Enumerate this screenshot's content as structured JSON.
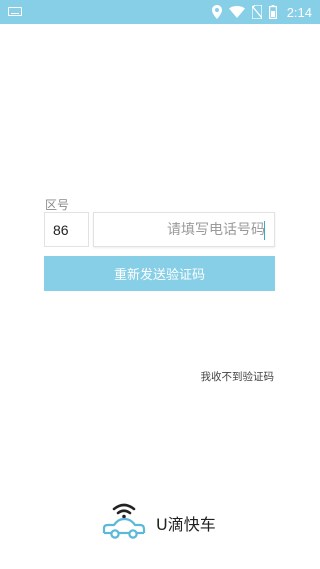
{
  "status_bar": {
    "time": "2:14",
    "icons": [
      "keyboard-icon",
      "location-icon",
      "wifi-icon",
      "no-sim-icon",
      "battery-icon"
    ],
    "background": "#87cfe6"
  },
  "login": {
    "area_label": "区号",
    "area_code": "86",
    "phone_placeholder": "请填写电话号码",
    "phone_value": "",
    "resend_label": "重新发送验证码",
    "no_code_link": "我收不到验证码"
  },
  "brand": {
    "name": "U滴快车",
    "icon": "wifi-car-icon",
    "accent": "#5bb8d8"
  },
  "colors": {
    "button": "#87cfe6",
    "button_text": "#ffffff",
    "caret": "#3aa8c8"
  }
}
